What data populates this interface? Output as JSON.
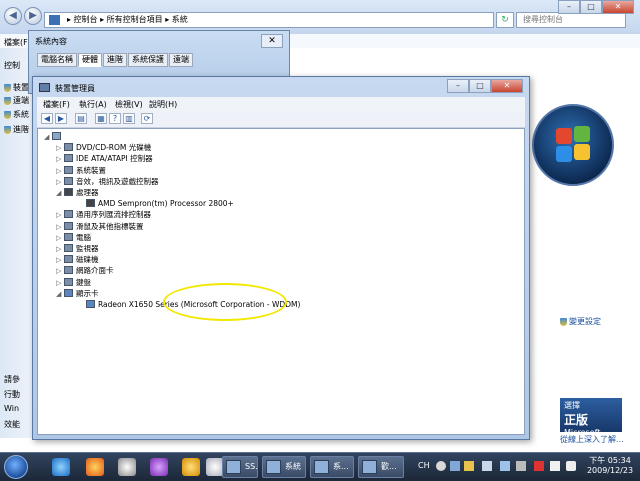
{
  "control_panel": {
    "breadcrumb": "▸ 控制台 ▸ 所有控制台項目 ▸ 系統",
    "search_placeholder": "搜尋控制台",
    "menu_label": "檔案(F)",
    "left_items": [
      "控制",
      "裝置",
      "遠端",
      "系統",
      "進階"
    ],
    "bottom_left": [
      "請參",
      "行動",
      "Win",
      "效能"
    ],
    "change_settings": "變更設定",
    "genuine": {
      "line1": "選擇",
      "big": "正版",
      "brand": "Microsoft",
      "line3": "軟體"
    },
    "genuine_link": "從線上深入了解..."
  },
  "system_properties": {
    "title": "系統內容",
    "tabs": [
      "電腦名稱",
      "硬體",
      "進階",
      "系統保護",
      "遠端"
    ],
    "active_tab": 1
  },
  "device_manager": {
    "title": "裝置管理員",
    "menus": [
      "檔案(F)",
      "執行(A)",
      "檢視(V)",
      "說明(H)"
    ],
    "tree": [
      {
        "label": "",
        "level": 0,
        "expander": "◢",
        "icon": "computer-icon"
      },
      {
        "label": "DVD/CD-ROM 光碟機",
        "level": 1,
        "expander": "▷",
        "icon": "dvd-icon"
      },
      {
        "label": "IDE ATA/ATAPI 控制器",
        "level": 1,
        "expander": "▷",
        "icon": "ide-icon"
      },
      {
        "label": "系統裝置",
        "level": 1,
        "expander": "▷",
        "icon": "system-device-icon"
      },
      {
        "label": "音效，視訊及遊戲控制器",
        "level": 1,
        "expander": "▷",
        "icon": "sound-icon"
      },
      {
        "label": "處理器",
        "level": 1,
        "expander": "◢",
        "icon": "cpu-icon"
      },
      {
        "label": "AMD Sempron(tm) Processor 2800+",
        "level": 2,
        "expander": "",
        "icon": "cpu-icon"
      },
      {
        "label": "通用序列匯流排控制器",
        "level": 1,
        "expander": "▷",
        "icon": "usb-icon"
      },
      {
        "label": "滑鼠及其他指標裝置",
        "level": 1,
        "expander": "▷",
        "icon": "mouse-icon"
      },
      {
        "label": "電腦",
        "level": 1,
        "expander": "▷",
        "icon": "computer-icon"
      },
      {
        "label": "監視器",
        "level": 1,
        "expander": "▷",
        "icon": "monitor-icon"
      },
      {
        "label": "磁碟機",
        "level": 1,
        "expander": "▷",
        "icon": "disk-icon"
      },
      {
        "label": "網路介面卡",
        "level": 1,
        "expander": "▷",
        "icon": "network-icon"
      },
      {
        "label": "鍵盤",
        "level": 1,
        "expander": "▷",
        "icon": "keyboard-icon"
      },
      {
        "label": "顯示卡",
        "level": 1,
        "expander": "◢",
        "icon": "display-adapter-icon"
      },
      {
        "label": "Radeon X1650 Series (Microsoft Corporation - WDDM)",
        "level": 2,
        "expander": "",
        "icon": "display-adapter-icon"
      }
    ]
  },
  "taskbar": {
    "tasks": [
      "SS...",
      "系統",
      "系...",
      "歡..."
    ],
    "tray_lang": "CH",
    "time": "下午 05:34",
    "date": "2009/12/23"
  }
}
